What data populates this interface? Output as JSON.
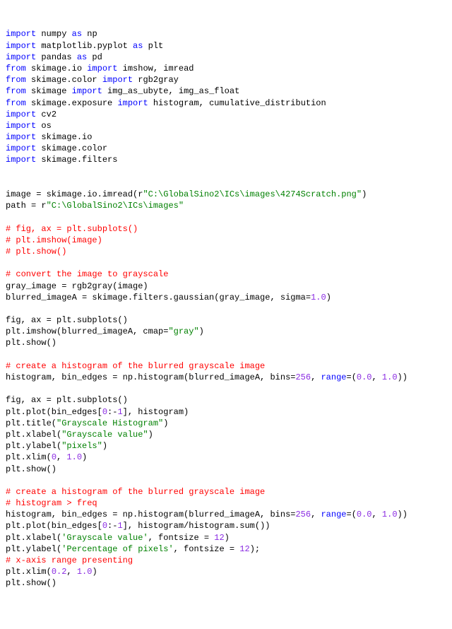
{
  "tokens": [
    [
      [
        "kw",
        "import"
      ],
      [
        "id",
        " numpy "
      ],
      [
        "kw",
        "as"
      ],
      [
        "id",
        " np"
      ]
    ],
    [
      [
        "kw",
        "import"
      ],
      [
        "id",
        " matplotlib.pyplot "
      ],
      [
        "kw",
        "as"
      ],
      [
        "id",
        " plt"
      ]
    ],
    [
      [
        "kw",
        "import"
      ],
      [
        "id",
        " pandas "
      ],
      [
        "kw",
        "as"
      ],
      [
        "id",
        " pd"
      ]
    ],
    [
      [
        "kw",
        "from"
      ],
      [
        "id",
        " skimage.io "
      ],
      [
        "kw",
        "import"
      ],
      [
        "id",
        " imshow, imread"
      ]
    ],
    [
      [
        "kw",
        "from"
      ],
      [
        "id",
        " skimage.color "
      ],
      [
        "kw",
        "import"
      ],
      [
        "id",
        " rgb2gray"
      ]
    ],
    [
      [
        "kw",
        "from"
      ],
      [
        "id",
        " skimage "
      ],
      [
        "kw",
        "import"
      ],
      [
        "id",
        " img_as_ubyte, img_as_float"
      ]
    ],
    [
      [
        "kw",
        "from"
      ],
      [
        "id",
        " skimage.exposure "
      ],
      [
        "kw",
        "import"
      ],
      [
        "id",
        " histogram, cumulative_distribution"
      ]
    ],
    [
      [
        "kw",
        "import"
      ],
      [
        "id",
        " cv2"
      ]
    ],
    [
      [
        "kw",
        "import"
      ],
      [
        "id",
        " os"
      ]
    ],
    [
      [
        "kw",
        "import"
      ],
      [
        "id",
        " skimage.io"
      ]
    ],
    [
      [
        "kw",
        "import"
      ],
      [
        "id",
        " skimage.color"
      ]
    ],
    [
      [
        "kw",
        "import"
      ],
      [
        "id",
        " skimage.filters"
      ]
    ],
    [],
    [],
    [
      [
        "id",
        "image = skimage.io.imread(r"
      ],
      [
        "str",
        "\"C:\\GlobalSino2\\ICs\\images\\4274Scratch.png\""
      ],
      [
        "id",
        ")"
      ]
    ],
    [
      [
        "id",
        "path = r"
      ],
      [
        "str",
        "\"C:\\GlobalSino2\\ICs\\images\""
      ]
    ],
    [],
    [
      [
        "com",
        "# fig, ax = plt.subplots()"
      ]
    ],
    [
      [
        "com",
        "# plt.imshow(image)"
      ]
    ],
    [
      [
        "com",
        "# plt.show()"
      ]
    ],
    [],
    [
      [
        "com",
        "# convert the image to grayscale"
      ]
    ],
    [
      [
        "id",
        "gray_image = rgb2gray(image)"
      ]
    ],
    [
      [
        "id",
        "blurred_imageA = skimage.filters.gaussian(gray_image, sigma="
      ],
      [
        "num",
        "1.0"
      ],
      [
        "id",
        ")"
      ]
    ],
    [],
    [
      [
        "id",
        "fig, ax = plt.subplots()"
      ]
    ],
    [
      [
        "id",
        "plt.imshow(blurred_imageA, cmap="
      ],
      [
        "str",
        "\"gray\""
      ],
      [
        "id",
        ")"
      ]
    ],
    [
      [
        "id",
        "plt.show()"
      ]
    ],
    [],
    [
      [
        "com",
        "# create a histogram of the blurred grayscale image"
      ]
    ],
    [
      [
        "id",
        "histogram, bin_edges = np.histogram(blurred_imageA, bins="
      ],
      [
        "num",
        "256"
      ],
      [
        "id",
        ", "
      ],
      [
        "kw",
        "range"
      ],
      [
        "id",
        "=("
      ],
      [
        "num",
        "0.0"
      ],
      [
        "id",
        ", "
      ],
      [
        "num",
        "1.0"
      ],
      [
        "id",
        "))"
      ]
    ],
    [],
    [
      [
        "id",
        "fig, ax = plt.subplots()"
      ]
    ],
    [
      [
        "id",
        "plt.plot(bin_edges["
      ],
      [
        "num",
        "0"
      ],
      [
        "id",
        ":-"
      ],
      [
        "num",
        "1"
      ],
      [
        "id",
        "], histogram)"
      ]
    ],
    [
      [
        "id",
        "plt.title("
      ],
      [
        "str",
        "\"Grayscale Histogram\""
      ],
      [
        "id",
        ")"
      ]
    ],
    [
      [
        "id",
        "plt.xlabel("
      ],
      [
        "str",
        "\"Grayscale value\""
      ],
      [
        "id",
        ")"
      ]
    ],
    [
      [
        "id",
        "plt.ylabel("
      ],
      [
        "str",
        "\"pixels\""
      ],
      [
        "id",
        ")"
      ]
    ],
    [
      [
        "id",
        "plt.xlim("
      ],
      [
        "num",
        "0"
      ],
      [
        "id",
        ", "
      ],
      [
        "num",
        "1.0"
      ],
      [
        "id",
        ")"
      ]
    ],
    [
      [
        "id",
        "plt.show()"
      ]
    ],
    [],
    [
      [
        "com",
        "# create a histogram of the blurred grayscale image"
      ]
    ],
    [
      [
        "com",
        "# histogram > freq"
      ]
    ],
    [
      [
        "id",
        "histogram, bin_edges = np.histogram(blurred_imageA, bins="
      ],
      [
        "num",
        "256"
      ],
      [
        "id",
        ", "
      ],
      [
        "kw",
        "range"
      ],
      [
        "id",
        "=("
      ],
      [
        "num",
        "0.0"
      ],
      [
        "id",
        ", "
      ],
      [
        "num",
        "1.0"
      ],
      [
        "id",
        "))"
      ]
    ],
    [
      [
        "id",
        "plt.plot(bin_edges["
      ],
      [
        "num",
        "0"
      ],
      [
        "id",
        ":-"
      ],
      [
        "num",
        "1"
      ],
      [
        "id",
        "], histogram/histogram.sum())"
      ]
    ],
    [
      [
        "id",
        "plt.xlabel("
      ],
      [
        "str",
        "'Grayscale value'"
      ],
      [
        "id",
        ", fontsize = "
      ],
      [
        "num",
        "12"
      ],
      [
        "id",
        ")"
      ]
    ],
    [
      [
        "id",
        "plt.ylabel("
      ],
      [
        "str",
        "'Percentage of pixels'"
      ],
      [
        "id",
        ", fontsize = "
      ],
      [
        "num",
        "12"
      ],
      [
        "id",
        ");"
      ]
    ],
    [
      [
        "com",
        "# x-axis range presenting"
      ]
    ],
    [
      [
        "id",
        "plt.xlim("
      ],
      [
        "num",
        "0.2"
      ],
      [
        "id",
        ", "
      ],
      [
        "num",
        "1.0"
      ],
      [
        "id",
        ")"
      ]
    ],
    [
      [
        "id",
        "plt.show()"
      ]
    ]
  ]
}
